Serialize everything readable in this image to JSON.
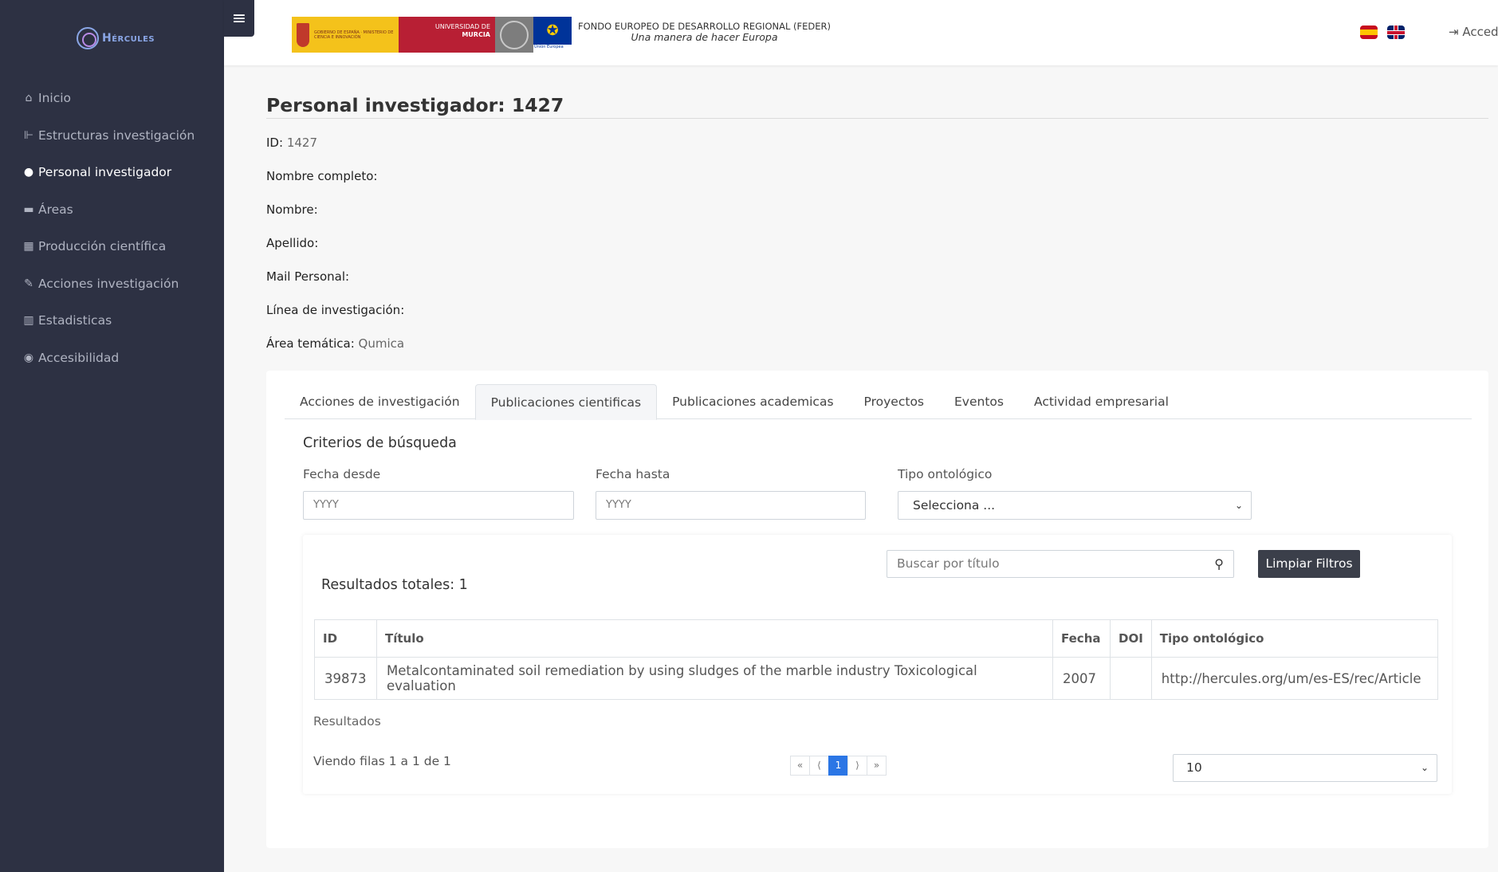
{
  "brand": {
    "name": "Hércules",
    "icon": "hercules-logo-icon"
  },
  "sidebar": {
    "items": [
      {
        "label": "Inicio",
        "icon": "home-icon",
        "glyph": "⌂"
      },
      {
        "label": "Estructuras investigación",
        "icon": "structure-icon",
        "glyph": "⊩"
      },
      {
        "label": "Personal investigador",
        "icon": "user-icon",
        "glyph": "●"
      },
      {
        "label": "Áreas",
        "icon": "folder-icon",
        "glyph": "▬"
      },
      {
        "label": "Producción científica",
        "icon": "box-icon",
        "glyph": "▦"
      },
      {
        "label": "Acciones investigación",
        "icon": "pencil-icon",
        "glyph": "✎"
      },
      {
        "label": "Estadisticas",
        "icon": "bar-chart-icon",
        "glyph": "▥"
      },
      {
        "label": "Accesibilidad",
        "icon": "eye-icon",
        "glyph": "◉"
      }
    ],
    "active_index": 2
  },
  "header": {
    "hamburger_icon": "menu-icon",
    "logos": {
      "gobierno": "GOBIERNO DE ESPAÑA · MINISTERIO DE CIENCIA E INNOVACIÓN",
      "um_line1": "UNIVERSIDAD DE",
      "um_line2": "MURCIA",
      "eu": "Unión Europea"
    },
    "feder_line1": "FONDO EUROPEO DE DESARROLLO REGIONAL (FEDER)",
    "feder_line2": "Una manera de hacer Europa",
    "login_label": "⇥ Acceder"
  },
  "page": {
    "title": "Personal investigador: 1427",
    "fields": [
      {
        "label": "ID:",
        "value": "1427"
      },
      {
        "label": "Nombre completo:",
        "value": ""
      },
      {
        "label": "Nombre:",
        "value": ""
      },
      {
        "label": "Apellido:",
        "value": ""
      },
      {
        "label": "Mail Personal:",
        "value": ""
      },
      {
        "label": "Línea de investigación:",
        "value": ""
      },
      {
        "label": "Área temática:",
        "value": "Qumica"
      }
    ]
  },
  "tabs": [
    "Acciones de investigación",
    "Publicaciones cientificas",
    "Publicaciones academicas",
    "Proyectos",
    "Eventos",
    "Actividad empresarial"
  ],
  "active_tab": 1,
  "criteria": {
    "title": "Criterios de búsqueda",
    "fecha_desde_label": "Fecha desde",
    "fecha_desde_placeholder": "YYYY",
    "fecha_hasta_label": "Fecha hasta",
    "fecha_hasta_placeholder": "YYYY",
    "tipo_label": "Tipo ontológico",
    "tipo_selected": "Selecciona ..."
  },
  "results": {
    "search_placeholder": "Buscar por título",
    "clear_label": "Limpiar Filtros",
    "total": "Resultados totales: 1",
    "columns": [
      "ID",
      "Título",
      "Fecha",
      "DOI",
      "Tipo ontológico"
    ],
    "rows": [
      [
        "39873",
        "Metalcontaminated soil remediation by using sludges of the marble industry Toxicological evaluation",
        "2007",
        "",
        "http://hercules.org/um/es-ES/rec/Article"
      ]
    ],
    "footer_label": "Resultados",
    "showing": "Viendo filas 1 a 1 de 1",
    "pager": [
      "«",
      "⟨",
      "1",
      "⟩",
      "»"
    ],
    "current_page": "1",
    "page_size": "10"
  }
}
